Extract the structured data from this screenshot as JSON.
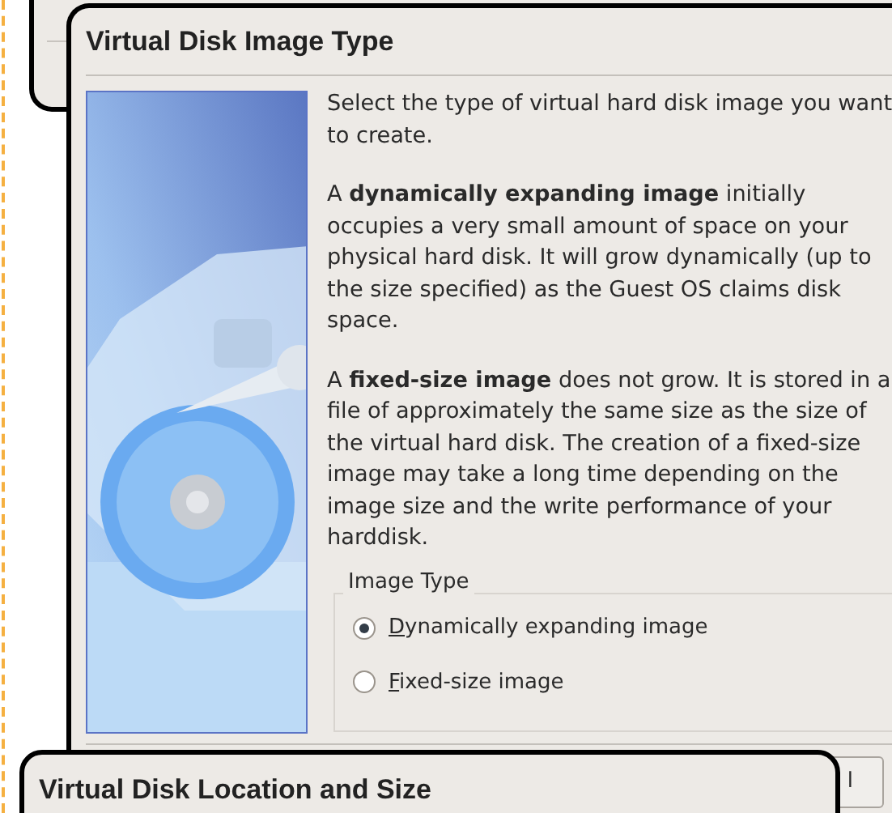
{
  "dialog": {
    "title": "Virtual Disk Image Type",
    "paragraphs": [
      "Select the type of virtual hard disk image you want to create.",
      "A **dynamically expanding image** initially occupies a very small amount of space on your physical hard disk. It will grow dynamically (up to the size specified) as the Guest OS claims disk space.",
      "A **fixed-size image** does not grow. It is stored in a file of approximately the same size as the size of the virtual hard disk. The creation of a fixed-size image may take a long time depending on the image size and the write performance of your harddisk."
    ],
    "image_type": {
      "title": "Image Type",
      "options": [
        {
          "mnemonic": "D",
          "rest": "ynamically expanding image",
          "selected": true
        },
        {
          "mnemonic": "F",
          "rest": "ixed-size image",
          "selected": false
        }
      ]
    },
    "button_fragment": "l"
  },
  "next_dialog": {
    "title": "Virtual Disk Location and Size"
  }
}
